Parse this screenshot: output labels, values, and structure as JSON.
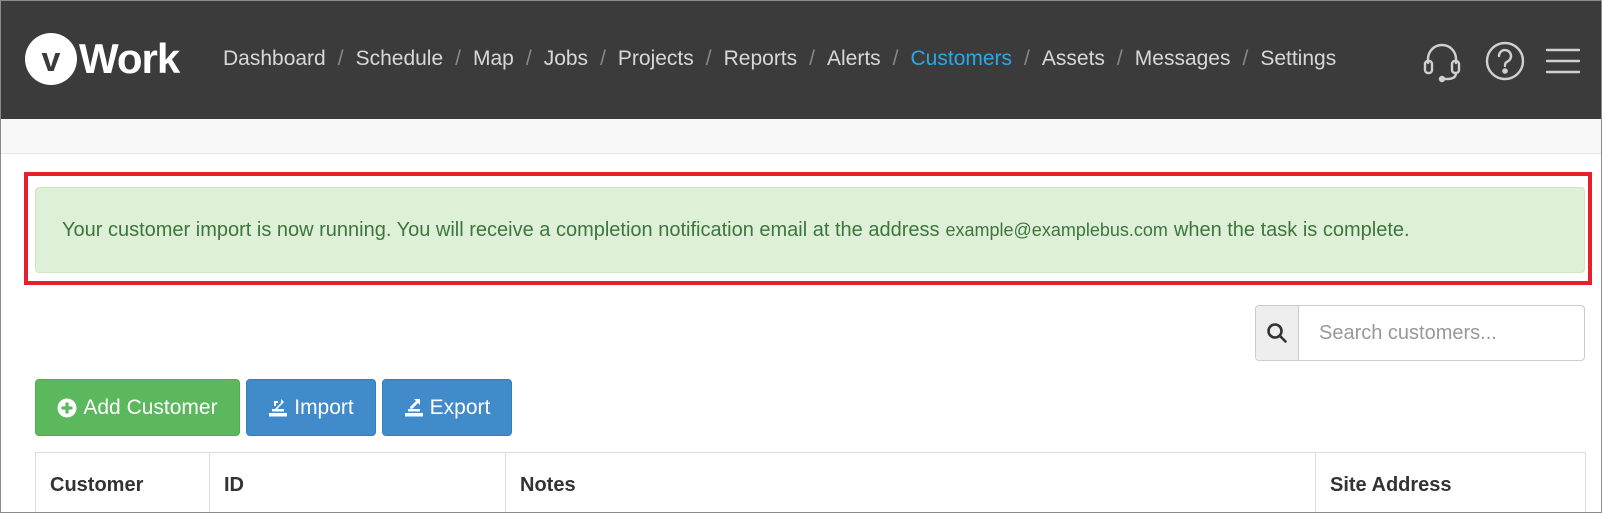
{
  "brand": {
    "logo_mark": "v",
    "name": "Work"
  },
  "nav": {
    "items": [
      {
        "label": "Dashboard",
        "active": false
      },
      {
        "label": "Schedule",
        "active": false
      },
      {
        "label": "Map",
        "active": false
      },
      {
        "label": "Jobs",
        "active": false
      },
      {
        "label": "Projects",
        "active": false
      },
      {
        "label": "Reports",
        "active": false
      },
      {
        "label": "Alerts",
        "active": false
      },
      {
        "label": "Customers",
        "active": true
      },
      {
        "label": "Assets",
        "active": false
      },
      {
        "label": "Messages",
        "active": false
      },
      {
        "label": "Settings",
        "active": false
      }
    ],
    "separator": "/",
    "icons": [
      "headset-icon",
      "help-icon",
      "hamburger-menu-icon"
    ]
  },
  "alert": {
    "text_before": "Your customer import is now running. You will receive a completion notification email at the address",
    "email": "example@examplebus.com",
    "text_after": "when the task is complete."
  },
  "search": {
    "placeholder": "Search customers...",
    "icon": "search-icon"
  },
  "toolbar": {
    "add_label": "Add Customer",
    "import_label": "Import",
    "export_label": "Export"
  },
  "table": {
    "columns": [
      "Customer",
      "ID",
      "Notes",
      "Site Address"
    ]
  },
  "colors": {
    "navbar_bg": "#3b3b3b",
    "nav_active": "#29a8e8",
    "alert_bg": "#dff0d8",
    "alert_text": "#3c763d",
    "highlight_border": "#e3222c",
    "btn_green": "#5cb85c",
    "btn_blue": "#428bca"
  }
}
